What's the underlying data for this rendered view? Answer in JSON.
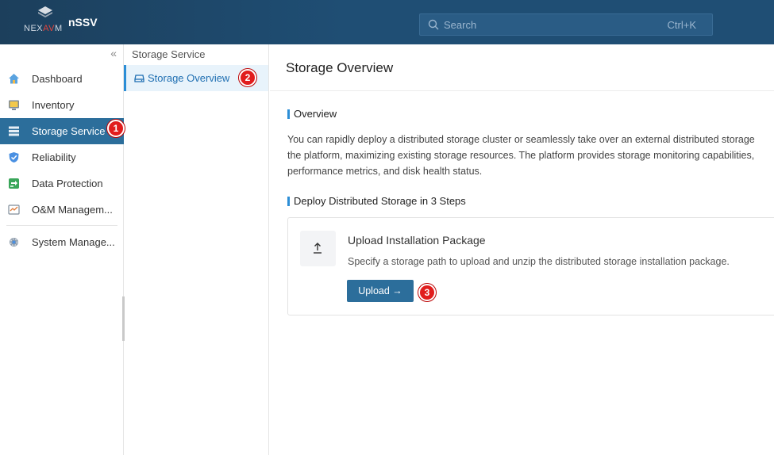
{
  "header": {
    "logo_text_1": "NEX",
    "logo_text_2": "AV",
    "logo_text_3": "M",
    "app_name": "nSSV",
    "search_placeholder": "Search",
    "search_shortcut": "Ctrl+K"
  },
  "sidebar": {
    "collapse_label": "«",
    "items": [
      {
        "label": "Dashboard",
        "icon": "home-icon"
      },
      {
        "label": "Inventory",
        "icon": "monitor-icon"
      },
      {
        "label": "Storage Service",
        "icon": "storage-icon",
        "active": true
      },
      {
        "label": "Reliability",
        "icon": "shield-icon"
      },
      {
        "label": "Data Protection",
        "icon": "data-protection-icon"
      },
      {
        "label": "O&M Managem...",
        "icon": "om-chart-icon"
      },
      {
        "label": "System Manage...",
        "icon": "gear-icon"
      }
    ]
  },
  "subnav": {
    "heading": "Storage Service",
    "item_label": "Storage Overview"
  },
  "badges": [
    "1",
    "2",
    "3"
  ],
  "main": {
    "title": "Storage Overview",
    "overview_heading": "Overview",
    "overview_lines": [
      "You can rapidly deploy a distributed storage cluster or seamlessly take over an external distributed storage",
      "the platform, maximizing existing storage resources. The platform provides storage monitoring capabilities,",
      "performance metrics, and disk health status."
    ],
    "deploy_heading": "Deploy Distributed Storage in 3 Steps",
    "step": {
      "title": "Upload Installation Package",
      "description": "Specify a storage path to upload and unzip the distributed storage installation package.",
      "button_label": "Upload →"
    }
  },
  "colors": {
    "header_bg": "#1f4e74",
    "active_nav": "#2c6e9b",
    "accent": "#2c8ed6",
    "badge": "#e11d1d"
  }
}
